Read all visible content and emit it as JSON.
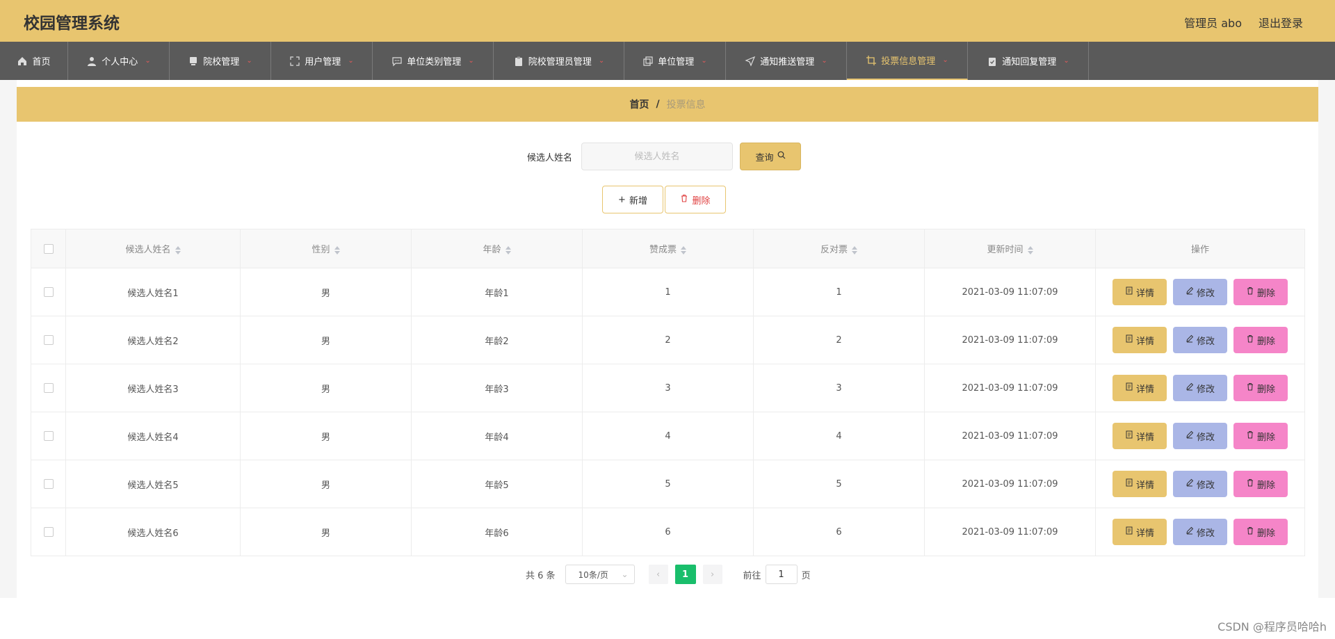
{
  "header": {
    "app_title": "校园管理系统",
    "admin_label": "管理员 abo",
    "logout_label": "退出登录"
  },
  "nav": {
    "items": [
      {
        "label": "首页",
        "icon": "home-icon"
      },
      {
        "label": "个人中心",
        "icon": "user-icon"
      },
      {
        "label": "院校管理",
        "icon": "monitor-icon"
      },
      {
        "label": "用户管理",
        "icon": "fullscreen-icon"
      },
      {
        "label": "单位类别管理",
        "icon": "chat-icon"
      },
      {
        "label": "院校管理员管理",
        "icon": "clipboard-icon"
      },
      {
        "label": "单位管理",
        "icon": "copy-icon"
      },
      {
        "label": "通知推送管理",
        "icon": "send-icon"
      },
      {
        "label": "投票信息管理",
        "icon": "crop-icon"
      },
      {
        "label": "通知回复管理",
        "icon": "clipboard-check-icon"
      }
    ],
    "active_index": 8
  },
  "breadcrumb": {
    "home": "首页",
    "separator": "/",
    "current": "投票信息"
  },
  "search": {
    "label": "候选人姓名",
    "placeholder": "候选人姓名",
    "value": "",
    "button_label": "查询"
  },
  "actions": {
    "add_label": "新增",
    "delete_label": "删除"
  },
  "table": {
    "columns": [
      "候选人姓名",
      "性别",
      "年龄",
      "赞成票",
      "反对票",
      "更新时间",
      "操作"
    ],
    "rows": [
      {
        "name": "候选人姓名1",
        "gender": "男",
        "age": "年龄1",
        "yes": "1",
        "no": "1",
        "updated": "2021-03-09 11:07:09"
      },
      {
        "name": "候选人姓名2",
        "gender": "男",
        "age": "年龄2",
        "yes": "2",
        "no": "2",
        "updated": "2021-03-09 11:07:09"
      },
      {
        "name": "候选人姓名3",
        "gender": "男",
        "age": "年龄3",
        "yes": "3",
        "no": "3",
        "updated": "2021-03-09 11:07:09"
      },
      {
        "name": "候选人姓名4",
        "gender": "男",
        "age": "年龄4",
        "yes": "4",
        "no": "4",
        "updated": "2021-03-09 11:07:09"
      },
      {
        "name": "候选人姓名5",
        "gender": "男",
        "age": "年龄5",
        "yes": "5",
        "no": "5",
        "updated": "2021-03-09 11:07:09"
      },
      {
        "name": "候选人姓名6",
        "gender": "男",
        "age": "年龄6",
        "yes": "6",
        "no": "6",
        "updated": "2021-03-09 11:07:09"
      }
    ],
    "row_actions": {
      "detail": "详情",
      "edit": "修改",
      "delete": "删除"
    }
  },
  "pagination": {
    "total_label": "共 6 条",
    "page_size": "10条/页",
    "current_page": "1",
    "goto_prefix": "前往",
    "goto_value": "1",
    "goto_suffix": "页"
  },
  "watermark": "CSDN @程序员哈哈h",
  "colors": {
    "accent": "#e8c56f",
    "nav_bg": "#5a5a5a",
    "edit": "#aab6e6",
    "delete": "#f585c8",
    "page_active": "#19be6b"
  }
}
